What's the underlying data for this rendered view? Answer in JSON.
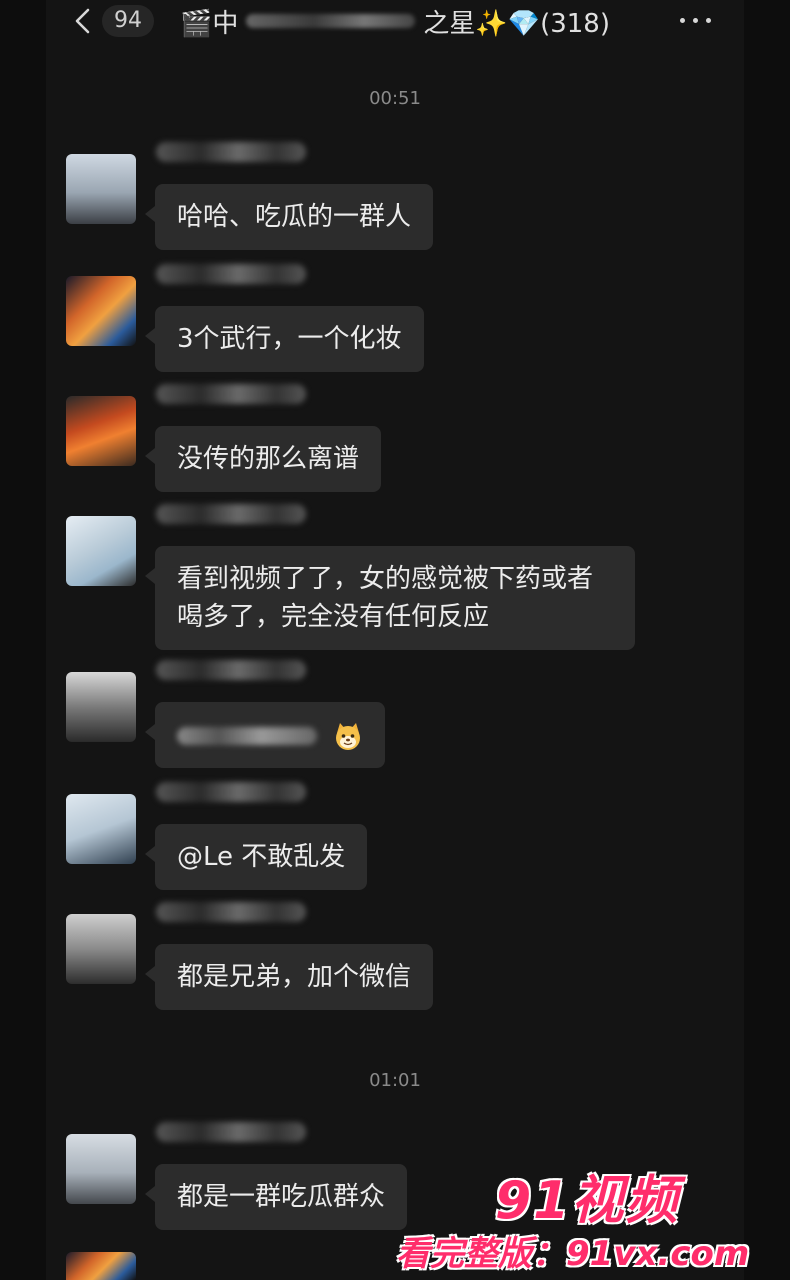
{
  "header": {
    "back_label": "94",
    "title_prefix": "🎬中",
    "title_suffix": "之星✨💎(318)"
  },
  "timestamps": [
    "00:51",
    "01:01"
  ],
  "messages": [
    {
      "text": "哈哈、吃瓜的一群人"
    },
    {
      "text": "3个武行，一个化妆"
    },
    {
      "text": "没传的那么离谱"
    },
    {
      "text": "看到视频了了，女的感觉被下药或者喝多了，完全没有任何反应"
    },
    {
      "text": "",
      "emoji": "cat-emoji"
    },
    {
      "text": "@Le  不敢乱发"
    },
    {
      "text": "都是兄弟，加个微信"
    },
    {
      "text": "都是一群吃瓜群众"
    }
  ],
  "watermark": {
    "brand": "91视频",
    "subtitle": "看完整版：91vx.com"
  },
  "colors": {
    "background": "#141414",
    "bubble": "#2c2c2c",
    "watermark": "#ff2d6b"
  }
}
